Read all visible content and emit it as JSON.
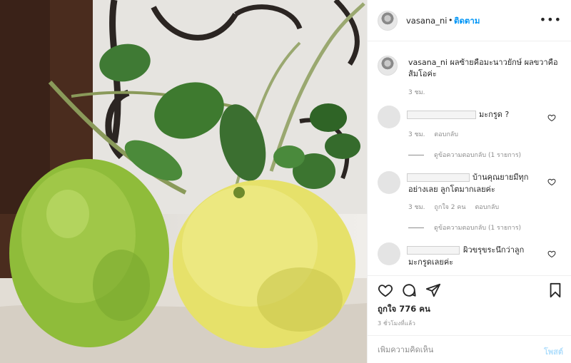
{
  "post": {
    "username": "vasana_ni",
    "follow_label": "ติดตาม",
    "separator": "•",
    "more_icon": "more-horizontal-icon",
    "caption": "ผลซ้ายคือมะนาวยักษ์ ผลขวาคือส้มโอค่ะ",
    "caption_time": "3 ชม."
  },
  "comments": [
    {
      "text": "มะกรูด ?",
      "time": "3 ชม.",
      "likes": "",
      "reply_label": "ตอบกลับ",
      "view_replies": "ดูข้อความตอบกลับ (1 รายการ)"
    },
    {
      "text_line1": "บ้านคุณยายมีทุก",
      "text_line2": "อย่างเลย ลูกโตมากเลยค่ะ",
      "time": "3 ชม.",
      "likes": "ถูกใจ 2 คน",
      "reply_label": "ตอบกลับ",
      "view_replies": "ดูข้อความตอบกลับ (1 รายการ)"
    },
    {
      "text_line1": "ผิวขรุขระนึกว่าลูก",
      "text_line2": "มะกรูดเลยค่ะ"
    }
  ],
  "actions": {
    "like_icon": "heart-icon",
    "comment_icon": "comment-icon",
    "share_icon": "share-icon",
    "save_icon": "bookmark-icon",
    "likes_count": "ถูกใจ 776 คน",
    "posted_time": "3 ชั่วโมงที่แล้ว"
  },
  "add_comment": {
    "placeholder": "เพิ่มความคิดเห็น",
    "post_label": "โพสต์"
  },
  "colors": {
    "accent": "#0095f6",
    "post_disabled": "#b2dffc",
    "muted": "#8e8e8e"
  }
}
